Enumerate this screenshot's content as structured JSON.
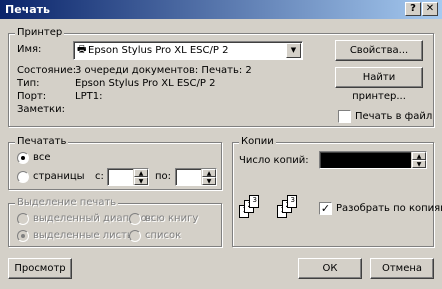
{
  "window": {
    "title": "Печать"
  },
  "printer": {
    "group_label": "Принтер",
    "name_label": "Имя:",
    "name_value": "Epson Stylus Pro XL ESC/P 2",
    "status_label": "Состояние:",
    "status_value": "3 очереди документов: Печать: 2",
    "type_label": "Тип:",
    "type_value": "Epson Stylus Pro XL ESC/P 2",
    "port_label": "Порт:",
    "port_value": "LPT1:",
    "comment_label": "Заметки:",
    "properties_button": "Свойства...",
    "find_button": "Найти принтер...",
    "print_to_file_label": "Печать в файл"
  },
  "print_range": {
    "group_label": "Печатать",
    "all_label": "все",
    "pages_label": "страницы",
    "from_label": "с:",
    "to_label": "по:"
  },
  "selection": {
    "group_label": "Выделение печать",
    "selected_range_label": "выделенный диапазон",
    "whole_book_label": "всю книгу",
    "selected_sheets_label": "выделенные листы",
    "list_label": "список"
  },
  "copies": {
    "group_label": "Копии",
    "count_label": "Число копий:",
    "collate_label": "Разобрать по копиям"
  },
  "footer": {
    "preview_button": "Просмотр",
    "ok_button": "ОК",
    "cancel_button": "Отмена"
  }
}
